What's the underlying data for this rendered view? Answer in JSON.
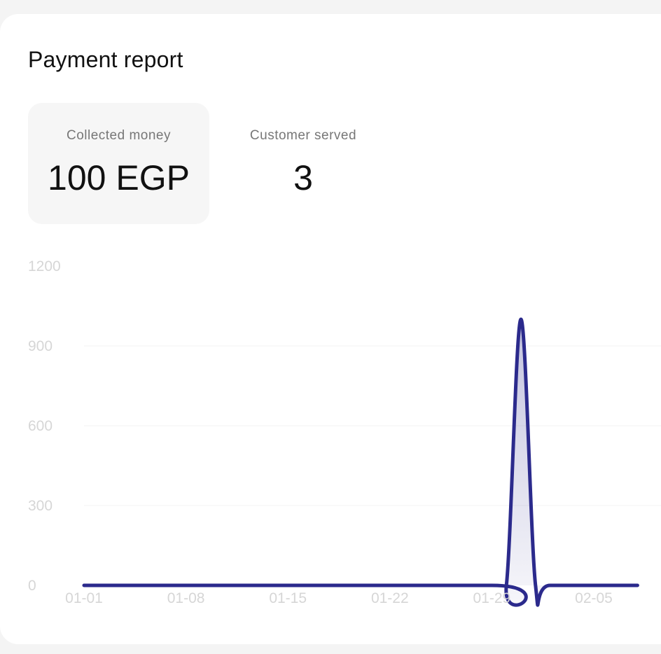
{
  "report": {
    "title": "Payment report"
  },
  "stats": [
    {
      "label": "Collected money",
      "value": "100 EGP",
      "selected": true
    },
    {
      "label": "Customer served",
      "value": "3",
      "selected": false
    }
  ],
  "colors": {
    "line": "#2b2a8c",
    "selected_card": "#f6f6f6",
    "tick_text": "#d6d6d6",
    "grid": "#f3f3f3"
  },
  "chart_data": {
    "type": "line",
    "x": [
      "01-01",
      "01-08",
      "01-15",
      "01-22",
      "01-29",
      "02-05"
    ],
    "xticks": [
      "01-01",
      "01-08",
      "01-15",
      "01-22",
      "01-29",
      "02-05"
    ],
    "y_ticks": [
      "0",
      "300",
      "600",
      "900",
      "1200"
    ],
    "ylim": [
      0,
      1200
    ],
    "series": [
      {
        "values": [
          {
            "x": "01-01",
            "y": 0
          },
          {
            "x": "01-29",
            "y": 0
          },
          {
            "x": "01-30",
            "y": 0
          },
          {
            "x": "01-31",
            "y": 1000
          },
          {
            "x": "02-01",
            "y": 0
          },
          {
            "x": "02-02",
            "y": 0
          },
          {
            "x": "02-08",
            "y": 0
          }
        ]
      }
    ],
    "grid": true
  }
}
